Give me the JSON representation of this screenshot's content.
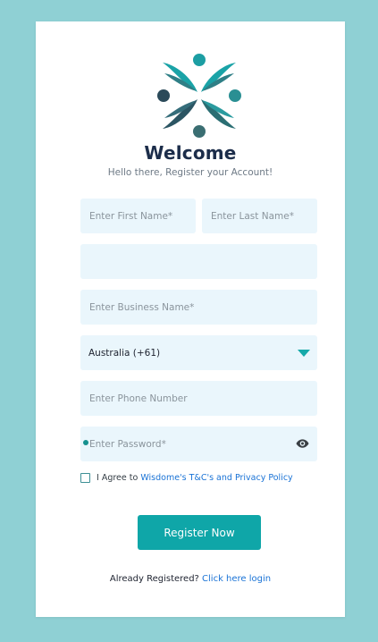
{
  "header": {
    "title": "Welcome",
    "subtitle": "Hello there, Register your Account!",
    "logo_icon": "people-circle-logo"
  },
  "form": {
    "first_name_placeholder": "Enter First Name*",
    "last_name_placeholder": "Enter Last Name*",
    "blank_field_value": "",
    "business_name_placeholder": "Enter Business Name*",
    "country_selected": "Australia (+61)",
    "phone_placeholder": "Enter Phone Number",
    "password_placeholder": "Enter Password*",
    "eye_icon": "eye-icon",
    "agree_prefix": "I Agree to ",
    "agree_link": "Wisdome's T&C's and Privacy Policy",
    "agree_checked": false
  },
  "actions": {
    "register_label": "Register Now",
    "already_text": "Already Registered? ",
    "login_link": "Click here login"
  },
  "colors": {
    "background": "#8fd0d4",
    "field_bg": "#eaf6fc",
    "accent": "#0fa6a8",
    "link": "#1a73d6",
    "title": "#1c2d4a"
  }
}
